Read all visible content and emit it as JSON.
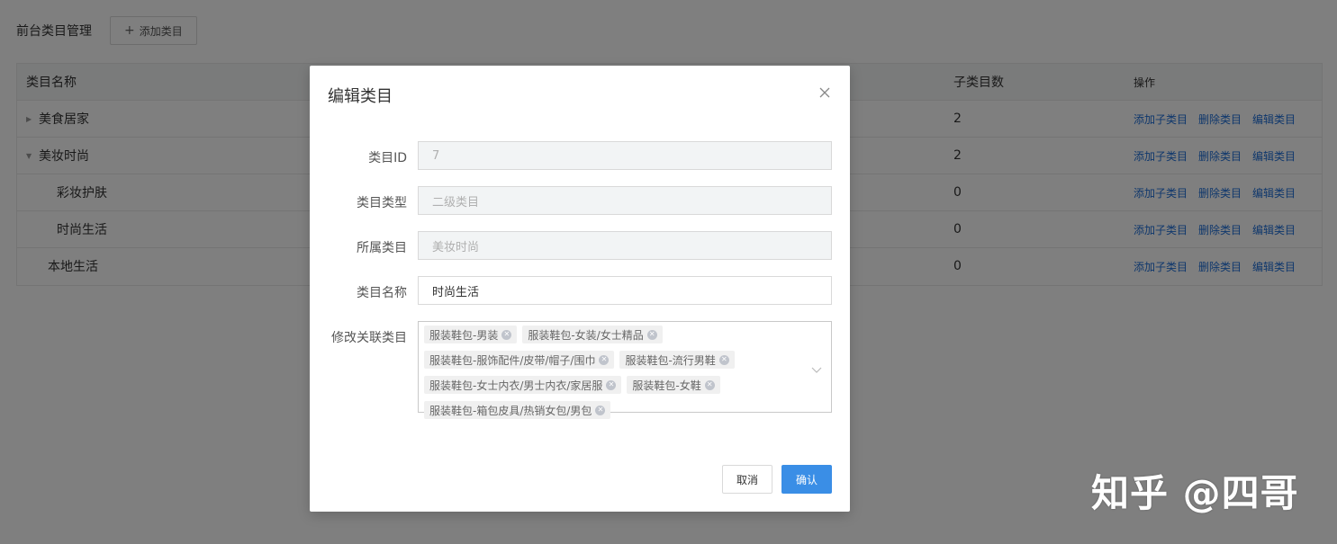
{
  "page": {
    "title": "前台类目管理",
    "add_button": "添加类目"
  },
  "table": {
    "headers": {
      "name": "类目名称",
      "count": "子类目数",
      "ops": "操作"
    },
    "rows": [
      {
        "name": "美食居家",
        "count": "2",
        "expanded": false,
        "level": 1
      },
      {
        "name": "美妆时尚",
        "count": "2",
        "expanded": true,
        "level": 1
      },
      {
        "name": "彩妆护肤",
        "count": "0",
        "level": 2
      },
      {
        "name": "时尚生活",
        "count": "0",
        "level": 2
      },
      {
        "name": "本地生活",
        "count": "0",
        "level": 1
      }
    ],
    "ops": {
      "add": "添加子类目",
      "delete": "删除类目",
      "edit": "编辑类目"
    }
  },
  "modal": {
    "title": "编辑类目",
    "fields": {
      "id_label": "类目ID",
      "id_value": "7",
      "type_label": "类目类型",
      "type_value": "二级类目",
      "parent_label": "所属类目",
      "parent_value": "美妆时尚",
      "name_label": "类目名称",
      "name_value": "时尚生活",
      "related_label": "修改关联类目"
    },
    "tags": [
      "服装鞋包-男装",
      "服装鞋包-女装/女士精品",
      "服装鞋包-服饰配件/皮带/帽子/围巾",
      "服装鞋包-流行男鞋",
      "服装鞋包-女士内衣/男士内衣/家居服",
      "服装鞋包-女鞋",
      "服装鞋包-箱包皮具/热销女包/男包"
    ],
    "cancel": "取消",
    "confirm": "确认"
  },
  "watermark": "知乎 @四哥",
  "colors": {
    "primary": "#3a8ee6",
    "link": "#1e6fd9",
    "overlay": "rgba(0,0,0,0.5)"
  }
}
